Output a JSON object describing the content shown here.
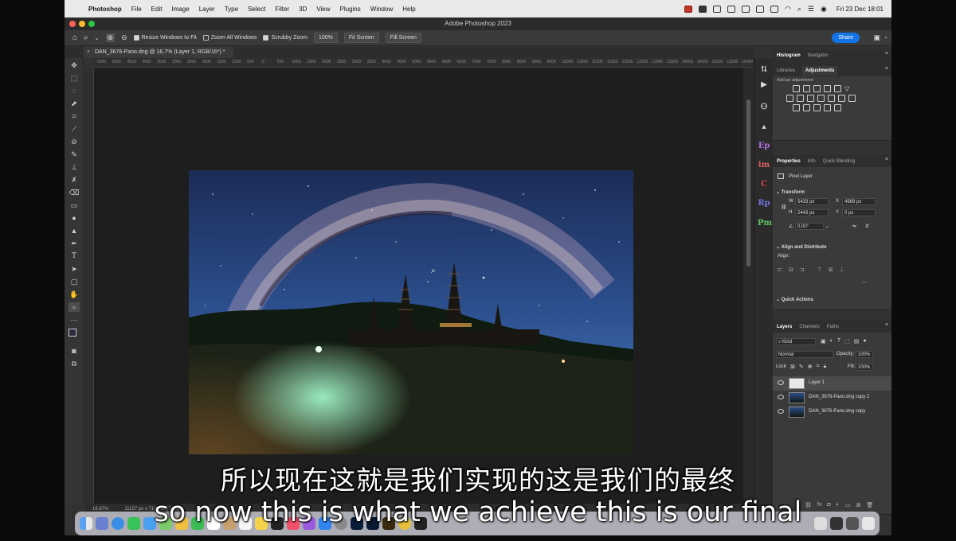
{
  "menubar": {
    "app_name": "Photoshop",
    "items": [
      "File",
      "Edit",
      "Image",
      "Layer",
      "Type",
      "Select",
      "Filter",
      "3D",
      "View",
      "Plugins",
      "Window",
      "Help"
    ],
    "clock": "Fri 23 Dec  18:01"
  },
  "window": {
    "title": "Adobe Photoshop 2023"
  },
  "options_bar": {
    "resize_windows_label": "Resize Windows to Fit",
    "zoom_all_label": "Zoom All Windows",
    "scrubby_zoom_label": "Scrubby Zoom",
    "zoom_value": "100%",
    "fit_screen_label": "Fit Screen",
    "fill_screen_label": "Fill Screen",
    "share_label": "Share"
  },
  "document_tab": {
    "title": "DAN_3676-Pano.dng @ 16,7% (Layer 1, RGB/16*) *"
  },
  "ruler": {
    "labels": [
      "5500",
      "5000",
      "4500",
      "4000",
      "3500",
      "3000",
      "2500",
      "2000",
      "1500",
      "1000",
      "500",
      "0",
      "500",
      "1000",
      "1500",
      "2000",
      "2500",
      "3000",
      "3500",
      "4000",
      "4500",
      "5000",
      "5500",
      "6000",
      "6500",
      "7000",
      "7500",
      "8000",
      "8500",
      "9000",
      "9500",
      "10000",
      "10500",
      "11000",
      "11500",
      "12000",
      "12500",
      "13000",
      "13500",
      "14000",
      "14500",
      "15000",
      "15500",
      "16000"
    ]
  },
  "status_bar": {
    "zoom": "16.67%",
    "doc_size": "11157 px x 7188 px (72 ppi)"
  },
  "panels": {
    "histogram_tabs": [
      "Histogram",
      "Navigator"
    ],
    "adjust_tabs": [
      "Libraries",
      "Adjustments"
    ],
    "add_adjustment_label": "Add an adjustment",
    "properties_tabs": [
      "Properties",
      "Info",
      "Quick Blending"
    ],
    "pixel_layer_label": "Pixel Layer",
    "transform_label": "Transform",
    "w_label": "W",
    "w_value": "5433 px",
    "x_label": "X",
    "x_value": "4989 px",
    "h_label": "H",
    "h_value": "2443 px",
    "y_label": "Y",
    "y_value": "0 px",
    "angle_value": "0,00°",
    "align_label": "Align and Distribute",
    "align_sub": "Align:",
    "quick_actions_label": "Quick Actions",
    "layers_tabs": [
      "Layers",
      "Channels",
      "Paths"
    ],
    "kind_label": "Kind",
    "blend_mode": "Normal",
    "opacity_label": "Opacity:",
    "opacity_value": "100%",
    "lock_label": "Lock:",
    "fill_label": "Fill:",
    "fill_value": "100%",
    "layers": [
      {
        "name": "Layer 1"
      },
      {
        "name": "DAN_3676-Pano.dng copy 2"
      },
      {
        "name": "DAN_3676-Pano.dng copy"
      }
    ]
  },
  "subtitles": {
    "chinese": "所以现在这就是我们实现的这是我们的最终",
    "english": "so now this is what we achieve this is our final"
  },
  "colors": {
    "menubar_bg": "#e9e9ea",
    "ps_dark": "#323232",
    "accent_blue": "#1473e6"
  }
}
